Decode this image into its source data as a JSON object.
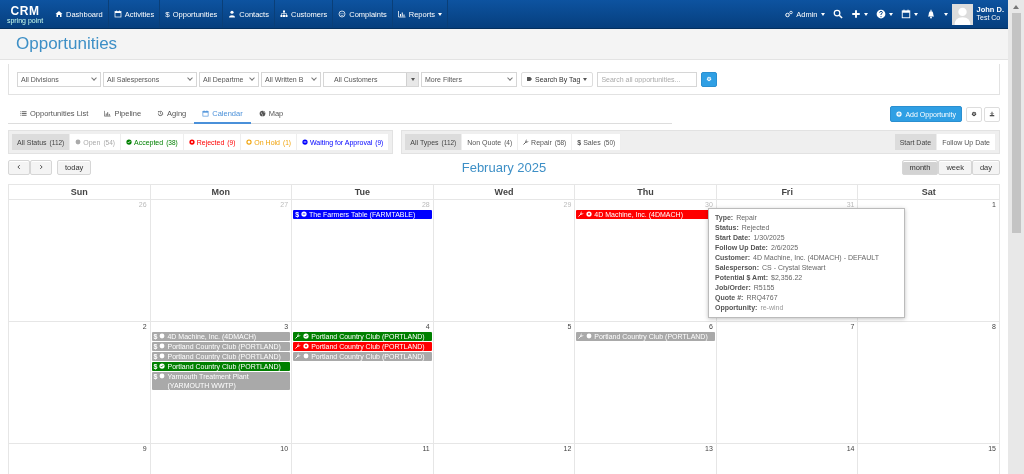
{
  "nav": {
    "logo": "CRM",
    "logo_tagline": "spring point",
    "items": [
      {
        "label": "Dashboard",
        "dropdown": false
      },
      {
        "label": "Activities",
        "dropdown": false
      },
      {
        "label": "Opportunities",
        "icon_text": "$",
        "dropdown": false
      },
      {
        "label": "Contacts",
        "dropdown": false
      },
      {
        "label": "Customers",
        "dropdown": false
      },
      {
        "label": "Complaints",
        "dropdown": false
      },
      {
        "label": "Reports",
        "dropdown": true
      }
    ],
    "admin": "Admin",
    "user_name": "John D.",
    "user_company": "Test Co"
  },
  "page_title": "Opportunities",
  "filters": [
    {
      "label": "All Divisions",
      "kind": "select"
    },
    {
      "label": "All Salespersons",
      "kind": "select"
    },
    {
      "label": "All Departme",
      "kind": "select"
    },
    {
      "label": "All Written B",
      "kind": "select"
    },
    {
      "label": "All Customers",
      "kind": "combo"
    },
    {
      "label": "More Filters",
      "kind": "select"
    }
  ],
  "tag_button": "Search By Tag",
  "search": {
    "placeholder": "Search all opportunities..."
  },
  "view_tabs": [
    {
      "label": "Opportunities List",
      "selected": false
    },
    {
      "label": "Pipeline",
      "selected": false
    },
    {
      "label": "Aging",
      "selected": false
    },
    {
      "label": "Calendar",
      "selected": true
    },
    {
      "label": "Map",
      "selected": false
    }
  ],
  "add_button": "Add Opportunity",
  "status_filters": [
    {
      "label": "All Status",
      "count": "(112)",
      "kind": "all",
      "selected": true
    },
    {
      "label": "Open",
      "count": "(54)",
      "kind": "open",
      "selected": false
    },
    {
      "label": "Accepted",
      "count": "(38)",
      "kind": "accepted",
      "selected": false
    },
    {
      "label": "Rejected",
      "count": "(9)",
      "kind": "rejected",
      "selected": false
    },
    {
      "label": "On Hold",
      "count": "(1)",
      "kind": "on_hold",
      "selected": false
    },
    {
      "label": "Waiting for Approval",
      "count": "(9)",
      "kind": "waiting",
      "selected": false
    }
  ],
  "type_filters": [
    {
      "label": "All Types",
      "count": "(112)",
      "kind": "all",
      "selected": true
    },
    {
      "label": "Non Quote",
      "count": "(4)",
      "kind": "non_quote",
      "selected": false
    },
    {
      "label": "Repair",
      "count": "(58)",
      "kind": "repair",
      "selected": false
    },
    {
      "label": "Sales",
      "count": "(50)",
      "kind": "sales",
      "icon_text": "$",
      "selected": false
    }
  ],
  "date_modes": [
    {
      "label": "Start Date",
      "selected": true
    },
    {
      "label": "Follow Up Date",
      "selected": false
    }
  ],
  "calendar": {
    "title": "February 2025",
    "today": "today",
    "views": [
      {
        "label": "month",
        "selected": true
      },
      {
        "label": "week",
        "selected": false
      },
      {
        "label": "day",
        "selected": false
      }
    ],
    "weekdays": [
      "Sun",
      "Mon",
      "Tue",
      "Wed",
      "Thu",
      "Fri",
      "Sat"
    ],
    "weeks": [
      [
        {
          "day": "26",
          "other_month": true
        },
        {
          "day": "27",
          "other_month": true
        },
        {
          "day": "28",
          "other_month": true,
          "events": [
            {
              "kind": "waiting",
              "color": "#0000ff",
              "icon_text": "$",
              "title": "The Farmers Table (FARMTABLE)"
            }
          ]
        },
        {
          "day": "29",
          "other_month": true
        },
        {
          "day": "30",
          "other_month": true,
          "events": [
            {
              "kind": "rejected",
              "color": "#ff0000",
              "title": "4D Machine, Inc. (4DMACH)"
            }
          ]
        },
        {
          "day": "31",
          "other_month": true
        },
        {
          "day": "1",
          "other_month": false
        }
      ],
      [
        {
          "day": "2",
          "other_month": false
        },
        {
          "day": "3",
          "other_month": false,
          "events": [
            {
              "kind": "open",
              "color": "#a9a9a9",
              "icon_text": "$",
              "title": "4D Machine, Inc. (4DMACH)"
            },
            {
              "kind": "open",
              "color": "#a9a9a9",
              "icon_text": "$",
              "title": "Portland Country Club (PORTLAND)"
            },
            {
              "kind": "open",
              "color": "#a9a9a9",
              "icon_text": "$",
              "title": "Portland Country Club (PORTLAND)"
            },
            {
              "kind": "accepted",
              "color": "#008000",
              "icon_text": "$",
              "title": "Portland Country Club (PORTLAND)"
            },
            {
              "kind": "open",
              "color": "#a9a9a9",
              "icon_text": "$",
              "title": "Yarmouth Treatment Plant (YARMOUTH WWTP)"
            }
          ]
        },
        {
          "day": "4",
          "other_month": false,
          "events": [
            {
              "kind": "accepted",
              "color": "#008000",
              "title": "Portland Country Club (PORTLAND)"
            },
            {
              "kind": "rejected",
              "color": "#ff0000",
              "title": "Portland Country Club (PORTLAND)"
            },
            {
              "kind": "open",
              "color": "#a9a9a9",
              "title": "Portland Country Club (PORTLAND)"
            }
          ]
        },
        {
          "day": "5",
          "other_month": false
        },
        {
          "day": "6",
          "other_month": false,
          "events": [
            {
              "kind": "open",
              "color": "#a9a9a9",
              "title": "Portland Country Club (PORTLAND)"
            }
          ]
        },
        {
          "day": "7",
          "other_month": false
        },
        {
          "day": "8",
          "other_month": false
        }
      ],
      [
        {
          "day": "9",
          "other_month": false
        },
        {
          "day": "10",
          "other_month": false
        },
        {
          "day": "11",
          "other_month": false
        },
        {
          "day": "12",
          "other_month": false
        },
        {
          "day": "13",
          "other_month": false
        },
        {
          "day": "14",
          "other_month": false
        },
        {
          "day": "15",
          "other_month": false
        }
      ]
    ]
  },
  "tooltip": [
    {
      "label": "Type:",
      "value": "Repair"
    },
    {
      "label": "Status:",
      "value": "Rejected"
    },
    {
      "label": "Start Date:",
      "value": "1/30/2025"
    },
    {
      "label": "Follow Up Date:",
      "value": "2/6/2025"
    },
    {
      "label": "Customer:",
      "value": "4D Machine, Inc. (4DMACH) - DEFAULT"
    },
    {
      "label": "Salesperson:",
      "value": "CS - Crystal Stewart"
    },
    {
      "label": "Potential $ Amt:",
      "value": "$2,356.22"
    },
    {
      "label": "Job/Order:",
      "value": "R5155"
    },
    {
      "label": "Quote #:",
      "value": "RRQ4767"
    },
    {
      "label": "Opportunity:",
      "value": "re-wind",
      "kind": "note"
    }
  ]
}
